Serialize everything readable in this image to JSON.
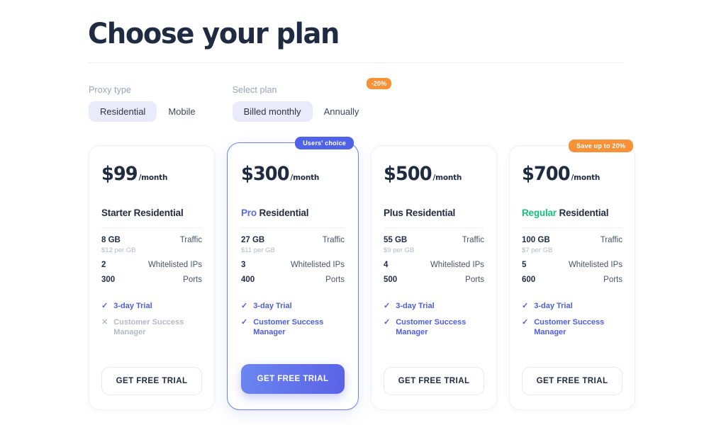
{
  "header": {
    "title": "Choose your plan"
  },
  "filters": [
    {
      "label": "Proxy type",
      "options": [
        {
          "label": "Residential",
          "selected": true
        },
        {
          "label": "Mobile",
          "selected": false
        }
      ]
    },
    {
      "label": "Select plan",
      "options": [
        {
          "label": "Billed monthly",
          "selected": true
        },
        {
          "label": "Annually",
          "selected": false
        }
      ],
      "badge": "-20%"
    }
  ],
  "spec_labels": {
    "traffic": "Traffic",
    "whitelisted_ips": "Whitelisted IPs",
    "ports": "Ports"
  },
  "plans": [
    {
      "ribbon": null,
      "price": "$99",
      "period": "/month",
      "name_accent": "",
      "name_rest": "Starter Residential",
      "traffic": "8 GB",
      "per_gb": "$12 per GB",
      "whitelisted_ips": "2",
      "ports": "300",
      "features": [
        {
          "label": "3-day Trial",
          "included": true
        },
        {
          "label": "Customer Success Manager",
          "included": false
        }
      ],
      "cta": "GET FREE TRIAL"
    },
    {
      "ribbon": "Users' choice",
      "price": "$300",
      "period": "/month",
      "name_accent": "Pro",
      "name_rest": "Residential",
      "traffic": "27 GB",
      "per_gb": "$11 per GB",
      "whitelisted_ips": "3",
      "ports": "400",
      "features": [
        {
          "label": "3-day Trial",
          "included": true
        },
        {
          "label": "Customer Success Manager",
          "included": true
        }
      ],
      "cta": "GET FREE TRIAL"
    },
    {
      "ribbon": null,
      "price": "$500",
      "period": "/month",
      "name_accent": "",
      "name_rest": "Plus Residential",
      "traffic": "55 GB",
      "per_gb": "$9 per GB",
      "whitelisted_ips": "4",
      "ports": "500",
      "features": [
        {
          "label": "3-day Trial",
          "included": true
        },
        {
          "label": "Customer Success Manager",
          "included": true
        }
      ],
      "cta": "GET FREE TRIAL"
    },
    {
      "ribbon": "Save up to 20%",
      "price": "$700",
      "period": "/month",
      "name_accent": "Regular",
      "name_rest": "Residential",
      "traffic": "100 GB",
      "per_gb": "$7 per GB",
      "whitelisted_ips": "5",
      "ports": "600",
      "features": [
        {
          "label": "3-day Trial",
          "included": true
        },
        {
          "label": "Customer Success Manager",
          "included": true
        }
      ],
      "cta": "GET FREE TRIAL"
    }
  ],
  "icons": {
    "check": "✓",
    "cross": "✕"
  },
  "colors": {
    "accent_blue": "#5868e8",
    "accent_green": "#17c07a",
    "accent_orange": "#f79239",
    "text_dark": "#1f2b41",
    "muted": "#b3b9c6"
  }
}
